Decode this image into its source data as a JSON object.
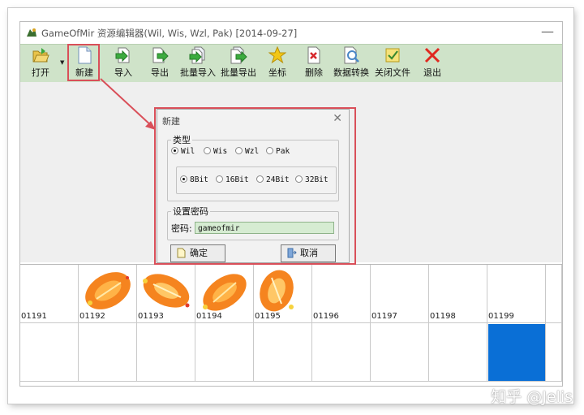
{
  "window": {
    "title": "GameOfMir 资源编辑器(Wil, Wis, Wzl, Pak) [2014-09-27]",
    "close_glyph": "—"
  },
  "toolbar": {
    "items": [
      {
        "label": "打开",
        "icon": "folder-open-icon"
      },
      {
        "label": "新建",
        "icon": "new-file-icon"
      },
      {
        "label": "导入",
        "icon": "import-icon"
      },
      {
        "label": "导出",
        "icon": "export-icon"
      },
      {
        "label": "批量导入",
        "icon": "batch-import-icon"
      },
      {
        "label": "批量导出",
        "icon": "batch-export-icon"
      },
      {
        "label": "坐标",
        "icon": "star-icon"
      },
      {
        "label": "删除",
        "icon": "delete-icon"
      },
      {
        "label": "数据转换",
        "icon": "convert-icon"
      },
      {
        "label": "关闭文件",
        "icon": "close-file-icon"
      },
      {
        "label": "退出",
        "icon": "exit-icon"
      }
    ],
    "dropdown_glyph": "▼"
  },
  "dialog": {
    "title": "新建",
    "close_glyph": "✕",
    "type_group": {
      "legend": "类型",
      "options": [
        "Wil",
        "Wis",
        "Wzl",
        "Pak"
      ],
      "selected": "Wil"
    },
    "bit_group": {
      "options": [
        "8Bit",
        "16Bit",
        "24Bit",
        "32Bit"
      ],
      "selected": "8Bit"
    },
    "password_group": {
      "legend": "设置密码",
      "label": "密码:",
      "value": "gameofmir"
    },
    "ok_label": "确定",
    "cancel_label": "取消"
  },
  "grid": {
    "row1": [
      "01191",
      "01192",
      "01193",
      "01194",
      "01195",
      "01196",
      "01197",
      "01198",
      "01199"
    ],
    "selected_color": "#0a6fd6"
  },
  "colors": {
    "toolbar_bg": "#cfe3c9",
    "highlight_red": "#d94f59",
    "password_field_bg": "#d6ecd2"
  },
  "watermark": "知乎 @Jelis"
}
